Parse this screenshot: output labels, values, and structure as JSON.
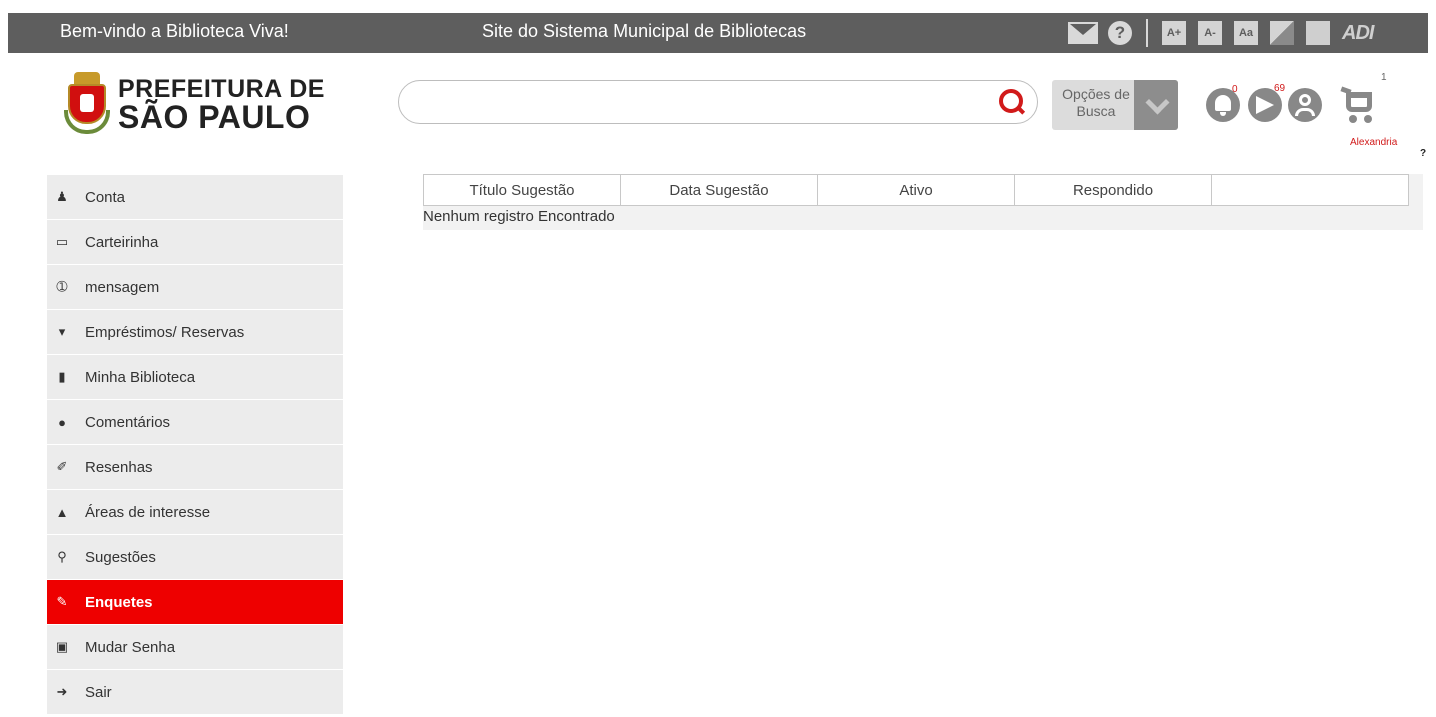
{
  "topbar": {
    "welcome": "Bem-vindo a Biblioteca Viva!",
    "site": "Site do Sistema Municipal de Bibliotecas",
    "font_plus": "A+",
    "font_minus": "A-",
    "font_reset": "Aa",
    "adi": "ADI"
  },
  "logo": {
    "line1": "PREFEITURA DE",
    "line2": "SÃO PAULO"
  },
  "search": {
    "value": "",
    "placeholder": ""
  },
  "search_options": {
    "label": "Opções de Busca"
  },
  "notifications": {
    "bell_count": "0",
    "messages_count": "69",
    "cart_count": "1"
  },
  "user": {
    "name": "Alexandria",
    "help": "?"
  },
  "sidebar": {
    "items": [
      {
        "label": "Conta",
        "icon": "user-icon"
      },
      {
        "label": "Carteirinha",
        "icon": "card-icon"
      },
      {
        "label": "mensagem",
        "icon": "info-icon"
      },
      {
        "label": "Empréstimos/ Reservas",
        "icon": "pin-icon"
      },
      {
        "label": "Minha Biblioteca",
        "icon": "book-icon"
      },
      {
        "label": "Comentários",
        "icon": "comment-icon"
      },
      {
        "label": "Resenhas",
        "icon": "pencil-icon"
      },
      {
        "label": "Áreas de interesse",
        "icon": "thumbs-up-icon"
      },
      {
        "label": "Sugestões",
        "icon": "lightbulb-icon"
      },
      {
        "label": "Enquetes",
        "icon": "edit-icon",
        "active": true
      },
      {
        "label": "Mudar Senha",
        "icon": "lock-icon"
      },
      {
        "label": "Sair",
        "icon": "sign-out-icon"
      }
    ]
  },
  "table": {
    "columns": [
      "Título Sugestão",
      "Data Sugestão",
      "Ativo",
      "Respondido",
      ""
    ],
    "empty_message": "Nenhum registro Encontrado"
  },
  "colors": {
    "accent": "#ee0000",
    "topbar": "#5e5e5e",
    "sidebar_bg": "#ececec"
  }
}
